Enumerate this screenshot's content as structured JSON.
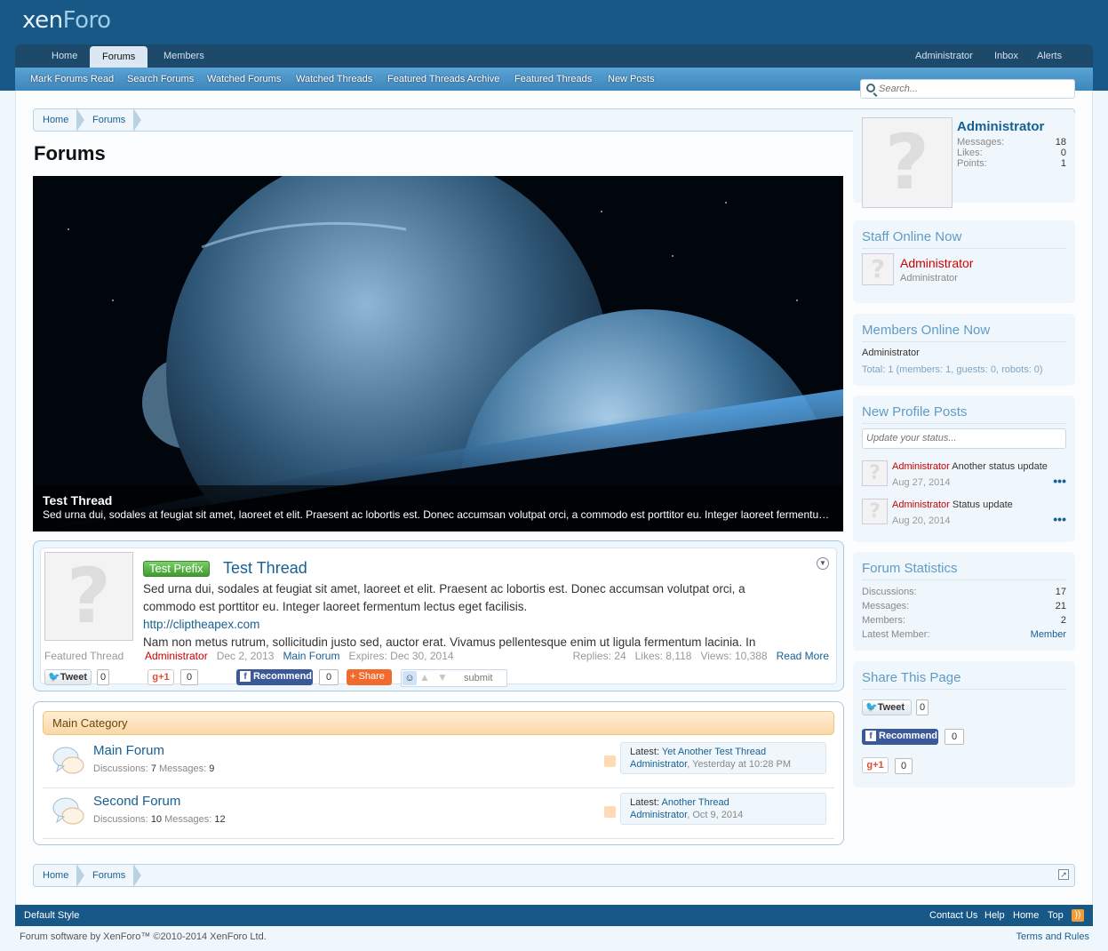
{
  "brand": {
    "logo_a": "xen",
    "logo_b": "Foro"
  },
  "nav": {
    "tabs": [
      "Home",
      "Forums",
      "Members"
    ],
    "selected": "Forums",
    "user_links": [
      "Administrator",
      "Inbox",
      "Alerts"
    ]
  },
  "subnav": [
    "Mark Forums Read",
    "Search Forums",
    "Watched Forums",
    "Watched Threads",
    "Featured Threads Archive",
    "Featured Threads",
    "New Posts"
  ],
  "search": {
    "placeholder": "Search..."
  },
  "breadcrumb": [
    "Home",
    "Forums"
  ],
  "page_title": "Forums",
  "slider": {
    "title": "Test Thread",
    "text": "Sed urna dui, sodales at feugiat sit amet, laoreet et elit. Praesent ac lobortis est. Donec accumsan volutpat orci, a commodo est porttitor eu. Integer laoreet fermentum lectus eget facilisis."
  },
  "featured": {
    "prefix": "Test Prefix",
    "title": "Test Thread",
    "label": "Featured Thread",
    "body1": "Sed urna dui, sodales at feugiat sit amet, laoreet et elit. Praesent ac lobortis est. Donec accumsan volutpat orci, a",
    "body2": "commodo est porttitor eu. Integer laoreet fermentum lectus eget facilisis.",
    "link": "http://cliptheapex.com",
    "body3": "Nam non metus rutrum, sollicitudin justo sed, auctor erat. Vivamus pellentesque enim ut ligula fermentum lacinia. In",
    "author": "Administrator",
    "date": "Dec 2, 2013",
    "forum": "Main Forum",
    "expires": "Expires: Dec 30, 2014",
    "stats": "Replies: 24   Likes: 8,118   Views: 10,388",
    "read_more": "Read More",
    "social": {
      "tweet": "Tweet",
      "tweet_count": "0",
      "gplus": "+1",
      "gplus_count": "0",
      "recommend": "Recommend",
      "recommend_count": "0",
      "share": "Share",
      "reddit_count": "0",
      "submit": "submit"
    }
  },
  "category": {
    "name": "Main Category",
    "forums": [
      {
        "name": "Main Forum",
        "discussions_label": "Discussions:",
        "discussions": "7",
        "messages_label": "Messages:",
        "messages": "9",
        "latest_label": "Latest:",
        "latest_thread": "Yet Another Test Thread",
        "latest_user": "Administrator",
        "latest_time": ", Yesterday at 10:28 PM"
      },
      {
        "name": "Second Forum",
        "discussions_label": "Discussions:",
        "discussions": "10",
        "messages_label": "Messages:",
        "messages": "12",
        "latest_label": "Latest:",
        "latest_thread": "Another Thread",
        "latest_user": "Administrator",
        "latest_time": ", Oct 9, 2014"
      }
    ]
  },
  "sidebar": {
    "visitor": {
      "name": "Administrator",
      "messages_label": "Messages:",
      "messages": "18",
      "likes_label": "Likes:",
      "likes": "0",
      "points_label": "Points:",
      "points": "1"
    },
    "staff": {
      "title": "Staff Online Now",
      "name": "Administrator",
      "role": "Administrator"
    },
    "members_online": {
      "title": "Members Online Now",
      "list": "Administrator",
      "total": "Total: 1 (members: 1, guests: 0, robots: 0)"
    },
    "profile_posts": {
      "title": "New Profile Posts",
      "placeholder": "Update your status...",
      "posts": [
        {
          "user": "Administrator",
          "text": "Another status update",
          "date": "Aug 27, 2014"
        },
        {
          "user": "Administrator",
          "text": "Status update",
          "date": "Aug 20, 2014"
        }
      ]
    },
    "stats": {
      "title": "Forum Statistics",
      "rows": [
        {
          "label": "Discussions:",
          "value": "17"
        },
        {
          "label": "Messages:",
          "value": "21"
        },
        {
          "label": "Members:",
          "value": "2"
        },
        {
          "label": "Latest Member:",
          "value": "Member"
        }
      ]
    },
    "share": {
      "title": "Share This Page",
      "tweet": "Tweet",
      "tweet_count": "0",
      "recommend": "Recommend",
      "recommend_count": "0",
      "gplus": "+1",
      "gplus_count": "0"
    }
  },
  "footer": {
    "style": "Default Style",
    "links": [
      "Contact Us",
      "Help",
      "Home",
      "Top"
    ],
    "copyright": "Forum software by XenForo™ ©2010-2014 XenForo Ltd.",
    "terms": "Terms and Rules"
  }
}
